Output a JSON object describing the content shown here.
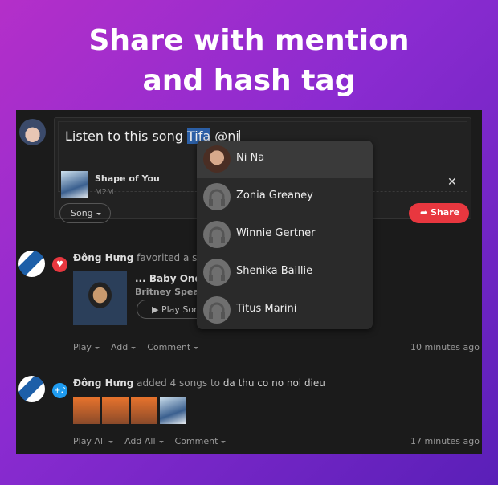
{
  "hero": {
    "line1": "Share with mention",
    "line2": "and hash tag"
  },
  "composer": {
    "text_before": "Listen to this song ",
    "selected": "Tifa",
    "text_after": " @ni",
    "attachment": {
      "title": "Shape of You",
      "artist": "M2M"
    },
    "song_button": "Song",
    "share_button": "Share"
  },
  "mention_dropdown": {
    "items": [
      {
        "name": "Ni Na",
        "active": true
      },
      {
        "name": "Zonia Greaney"
      },
      {
        "name": "Winnie Gertner"
      },
      {
        "name": "Shenika Baillie"
      },
      {
        "name": "Titus Marini"
      }
    ]
  },
  "feed": [
    {
      "user": "Đông Hưng",
      "action": "favorited a song",
      "song_title": "... Baby One More Time",
      "artist": "Britney Spears",
      "play_button": "Play Song",
      "actions": [
        "Play",
        "Add",
        "Comment"
      ],
      "time": "10 minutes ago",
      "badge_color": "#e8373f"
    },
    {
      "user": "Đông Hưng",
      "action_pre": "added",
      "count": "4 songs",
      "action_mid": "to",
      "playlist": "da thu co no noi dieu",
      "actions": [
        "Play All",
        "Add All",
        "Comment"
      ],
      "time": "17 minutes ago",
      "badge_color": "#1e9bf0"
    }
  ],
  "colors": {
    "accent": "#e8373f",
    "selection": "#2b5fa6",
    "panel": "#1b1b1b"
  }
}
